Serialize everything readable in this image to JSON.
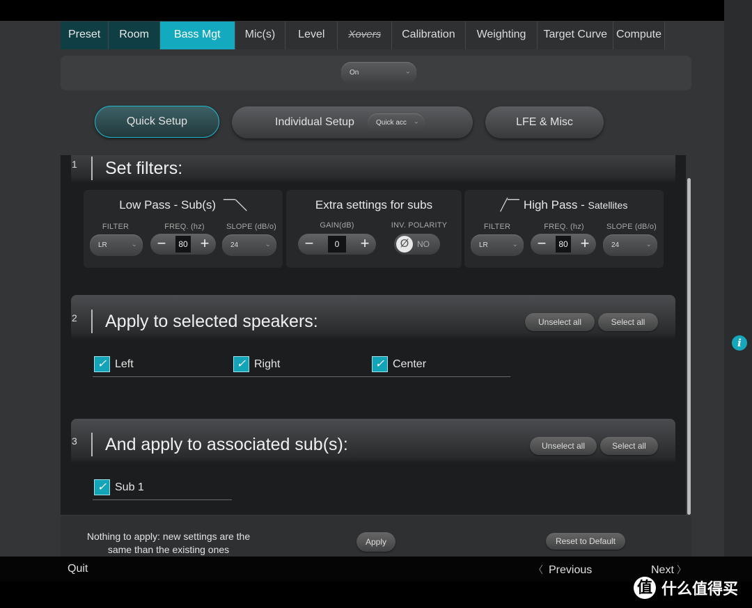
{
  "tabs": [
    {
      "label": "Preset"
    },
    {
      "label": "Room"
    },
    {
      "label": "Bass Mgt"
    },
    {
      "label": "Mic(s)"
    },
    {
      "label": "Level"
    },
    {
      "label": "Xovers"
    },
    {
      "label": "Calibration"
    },
    {
      "label": "Weighting"
    },
    {
      "label": "Target Curve"
    },
    {
      "label": "Compute"
    }
  ],
  "active_tab": "Bass Mgt",
  "bass_mode_select": {
    "value": "On"
  },
  "modes": {
    "quick_setup": "Quick Setup",
    "individual_setup": "Individual Setup",
    "individual_select": "Quick acc",
    "lfe_misc": "LFE & Misc"
  },
  "section1": {
    "number": "1",
    "title": "Set filters:",
    "low_pass": {
      "title": "Low Pass - Sub(s)",
      "filter_label": "FILTER",
      "filter_value": "LR",
      "freq_label": "FREQ. (hz)",
      "freq_value": "80",
      "slope_label": "SLOPE (dB/o)",
      "slope_value": "24"
    },
    "extra": {
      "title": "Extra settings for subs",
      "gain_label": "GAIN(dB)",
      "gain_value": "0",
      "polarity_label": "INV. POLARITY",
      "polarity_symbol": "Ø",
      "polarity_value": "NO"
    },
    "high_pass": {
      "title": "High Pass",
      "title_suffix": "Satellites",
      "filter_label": "FILTER",
      "filter_value": "LR",
      "freq_label": "FREQ. (hz)",
      "freq_value": "80",
      "slope_label": "SLOPE (dB/o)",
      "slope_value": "24"
    }
  },
  "section2": {
    "number": "2",
    "title": "Apply to selected speakers:",
    "unselect_all": "Unselect all",
    "select_all": "Select all",
    "speakers": [
      {
        "label": "Left",
        "checked": true
      },
      {
        "label": "Right",
        "checked": true
      },
      {
        "label": "Center",
        "checked": true
      }
    ]
  },
  "section3": {
    "number": "3",
    "title": "And apply to associated sub(s):",
    "unselect_all": "Unselect all",
    "select_all": "Select all",
    "subs": [
      {
        "label": "Sub 1",
        "checked": true
      }
    ]
  },
  "footer": {
    "message": "Nothing to apply: new settings are the same than the existing ones",
    "apply": "Apply",
    "reset": "Reset to Default"
  },
  "nav": {
    "quit": "Quit",
    "previous": "Previous",
    "next": "Next"
  },
  "watermark": {
    "logo": "值",
    "text": "什么值得买"
  },
  "colors": {
    "accent": "#13a9be",
    "background": "#333537",
    "panel": "#1c1d1f"
  }
}
